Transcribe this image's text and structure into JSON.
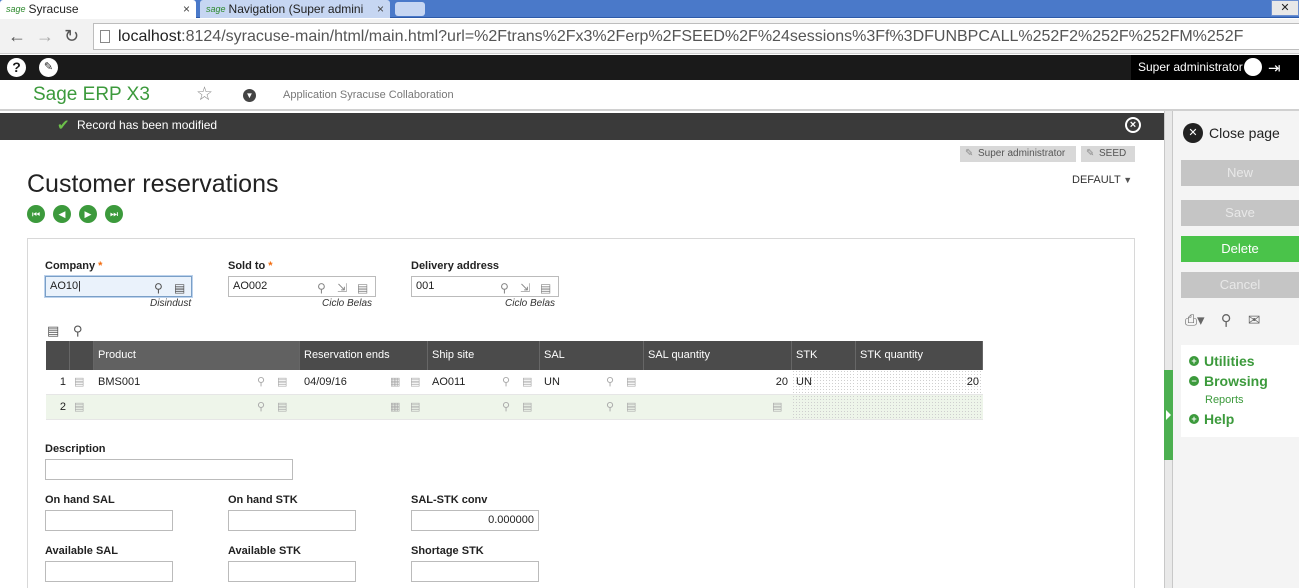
{
  "browser": {
    "tabs": [
      {
        "icon": "sage",
        "title": "Syracuse",
        "active": true
      },
      {
        "icon": "sage",
        "title": "Navigation (Super admini",
        "active": false
      }
    ],
    "url_host": "localhost",
    "url_rest": ":8124/syracuse-main/html/main.html?url=%2Ftrans%2Fx3%2Ferp%2FSEED%2F%24sessions%3Ff%3DFUNBPCALL%252F2%252F%252FM%252F"
  },
  "topbar": {
    "help_icon": "?",
    "user_label": "Super administrator"
  },
  "header": {
    "logo_sage": "Sage",
    "logo_product": "ERP X3",
    "app_label": "Application Syracuse Collaboration"
  },
  "message": {
    "text": "Record has been modified"
  },
  "chips": {
    "user": "Super administrator",
    "folder": "SEED"
  },
  "page": {
    "title": "Customer reservations",
    "view": "DEFAULT"
  },
  "form": {
    "company": {
      "label": "Company",
      "value": "AO10",
      "subtext": "Disindust"
    },
    "sold_to": {
      "label": "Sold to",
      "value": "AO002",
      "subtext": "Ciclo Belas"
    },
    "delivery": {
      "label": "Delivery address",
      "value": "001",
      "subtext": "Ciclo Belas"
    },
    "description": {
      "label": "Description",
      "value": ""
    },
    "on_hand_sal": {
      "label": "On hand SAL",
      "value": ""
    },
    "on_hand_stk": {
      "label": "On hand STK",
      "value": ""
    },
    "sal_stk_conv": {
      "label": "SAL-STK conv",
      "value": "0.000000"
    },
    "available_sal": {
      "label": "Available SAL",
      "value": ""
    },
    "available_stk": {
      "label": "Available STK",
      "value": ""
    },
    "shortage_stk": {
      "label": "Shortage STK",
      "value": ""
    }
  },
  "grid": {
    "columns": [
      "Product",
      "Reservation ends",
      "Ship site",
      "SAL",
      "SAL quantity",
      "STK",
      "STK quantity"
    ],
    "rows": [
      {
        "n": "1",
        "product": "BMS001",
        "ends": "04/09/16",
        "site": "AO011",
        "sal": "UN",
        "sal_qty": "20",
        "stk": "UN",
        "stk_qty": "20"
      },
      {
        "n": "2",
        "product": "",
        "ends": "",
        "site": "",
        "sal": "",
        "sal_qty": "",
        "stk": "",
        "stk_qty": ""
      }
    ]
  },
  "actions": {
    "close_page": "Close page",
    "new": "New",
    "save": "Save",
    "delete": "Delete",
    "cancel": "Cancel"
  },
  "sidemenu": {
    "utilities": "Utilities",
    "browsing": "Browsing",
    "reports": "Reports",
    "help": "Help"
  },
  "colors": {
    "accent_green": "#4ac34a",
    "brand_green": "#3c9a3c",
    "required_orange": "#f26c0f"
  }
}
